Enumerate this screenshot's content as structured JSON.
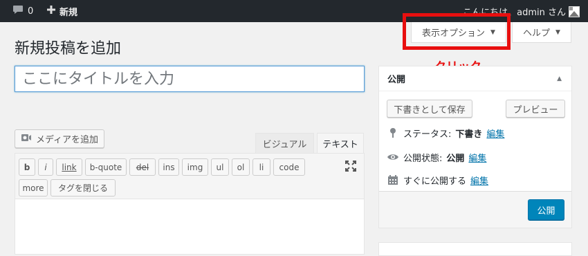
{
  "adminbar": {
    "comments_count": "0",
    "new_label": "新規",
    "greeting": "こんにちは、admin さん"
  },
  "screen_tabs": {
    "screen_options": "表示オプション",
    "help": "ヘルプ"
  },
  "annotation": {
    "click_note": "クリック",
    "color": "#e80f0f"
  },
  "page": {
    "title": "新規投稿を追加"
  },
  "title_field": {
    "placeholder": "ここにタイトルを入力",
    "value": ""
  },
  "editor": {
    "add_media": "メディアを追加",
    "tabs": [
      "ビジュアル",
      "テキスト"
    ],
    "active_tab": "テキスト",
    "quicktags": [
      "b",
      "i",
      "link",
      "b-quote",
      "del",
      "ins",
      "img",
      "ul",
      "ol",
      "li",
      "code",
      "more",
      "タグを閉じる"
    ]
  },
  "publish": {
    "heading": "公開",
    "save_draft": "下書きとして保存",
    "preview": "プレビュー",
    "status_label": "ステータス:",
    "status_value": "下書き",
    "visibility_label": "公開状態:",
    "visibility_value": "公開",
    "schedule_label": "すぐに公開する",
    "edit_link": "編集",
    "publish_button": "公開",
    "accent": "#0085ba"
  },
  "icons": [
    "comment-icon",
    "plus-icon",
    "avatar-icon",
    "caret-down-icon",
    "media-icon",
    "fullscreen-icon",
    "pin-icon",
    "eye-icon",
    "calendar-icon",
    "collapse-arrow-icon"
  ]
}
